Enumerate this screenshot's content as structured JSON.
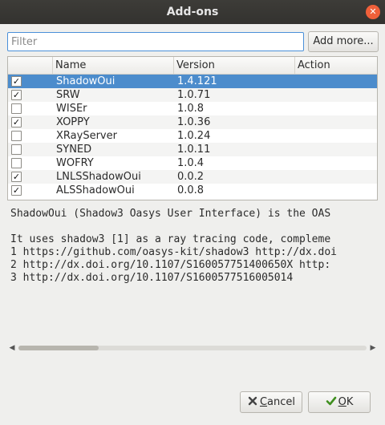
{
  "window": {
    "title": "Add-ons"
  },
  "filter": {
    "placeholder": "Filter",
    "value": ""
  },
  "add_more_label": "Add more...",
  "table": {
    "headers": {
      "checkbox": "",
      "name": "Name",
      "version": "Version",
      "action": "Action"
    },
    "rows": [
      {
        "name": "ShadowOui",
        "version": "1.4.121",
        "checked": true,
        "selected": true
      },
      {
        "name": "SRW",
        "version": "1.0.71",
        "checked": true,
        "selected": false
      },
      {
        "name": "WISEr",
        "version": "1.0.8",
        "checked": false,
        "selected": false
      },
      {
        "name": "XOPPY",
        "version": "1.0.36",
        "checked": true,
        "selected": false
      },
      {
        "name": "XRayServer",
        "version": "1.0.24",
        "checked": false,
        "selected": false
      },
      {
        "name": "SYNED",
        "version": "1.0.11",
        "checked": false,
        "selected": false
      },
      {
        "name": "WOFRY",
        "version": "1.0.4",
        "checked": false,
        "selected": false
      },
      {
        "name": "LNLSShadowOui",
        "version": "0.0.2",
        "checked": true,
        "selected": false
      },
      {
        "name": "ALSShadowOui",
        "version": "0.0.8",
        "checked": true,
        "selected": false
      }
    ]
  },
  "description": {
    "lines": [
      "ShadowOui (Shadow3 Oasys User Interface) is the OAS",
      "",
      "It uses shadow3 [1] as a ray tracing code, compleme",
      "1 https://github.com/oasys-kit/shadow3 http://dx.doi",
      "2 http://dx.doi.org/10.1107/S160057751400650X http:",
      "3 http://dx.doi.org/10.1107/S1600577516005014"
    ]
  },
  "buttons": {
    "cancel_prefix": "",
    "cancel_accel": "C",
    "cancel_rest": "ancel",
    "ok_prefix": "",
    "ok_accel": "O",
    "ok_rest": "K"
  },
  "icons": {
    "close": "close-icon",
    "cancel": "cancel-icon",
    "ok": "checkmark-icon",
    "check": "checkbox-checked"
  },
  "colors": {
    "selection": "#4c8ccc",
    "close": "#f0603a",
    "focus": "#4a90d9"
  }
}
